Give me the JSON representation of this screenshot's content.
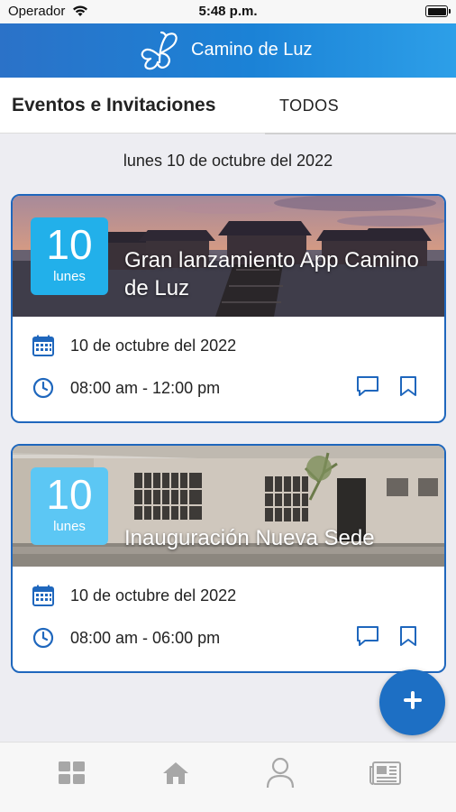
{
  "status_bar": {
    "carrier": "Operador",
    "time": "5:48 p.m."
  },
  "header": {
    "title": "Camino de Luz",
    "logo_icon": "butterfly-icon"
  },
  "tabs": {
    "events_label": "Eventos e Invitaciones",
    "all_label": "TODOS"
  },
  "date_header": "lunes 10 de octubre del 2022",
  "events": [
    {
      "day_number": "10",
      "day_name": "lunes",
      "title": "Gran lanzamiento App Camino de Luz",
      "date": "10 de octubre del 2022",
      "time": "08:00 am - 12:00 pm",
      "badge_color": "#22b0ea"
    },
    {
      "day_number": "10",
      "day_name": "lunes",
      "title": "Inauguración Nueva Sede",
      "date": "10 de octubre del 2022",
      "time": "08:00 am - 06:00 pm",
      "badge_color": "#5cc7f4"
    }
  ],
  "fab": {
    "icon": "plus-icon"
  },
  "bottom_nav": [
    "grid-icon",
    "home-icon",
    "profile-icon",
    "news-icon"
  ],
  "colors": {
    "primary": "#1f67bd",
    "accent": "#22b0ea",
    "icon_gray": "#a7a7a7"
  }
}
